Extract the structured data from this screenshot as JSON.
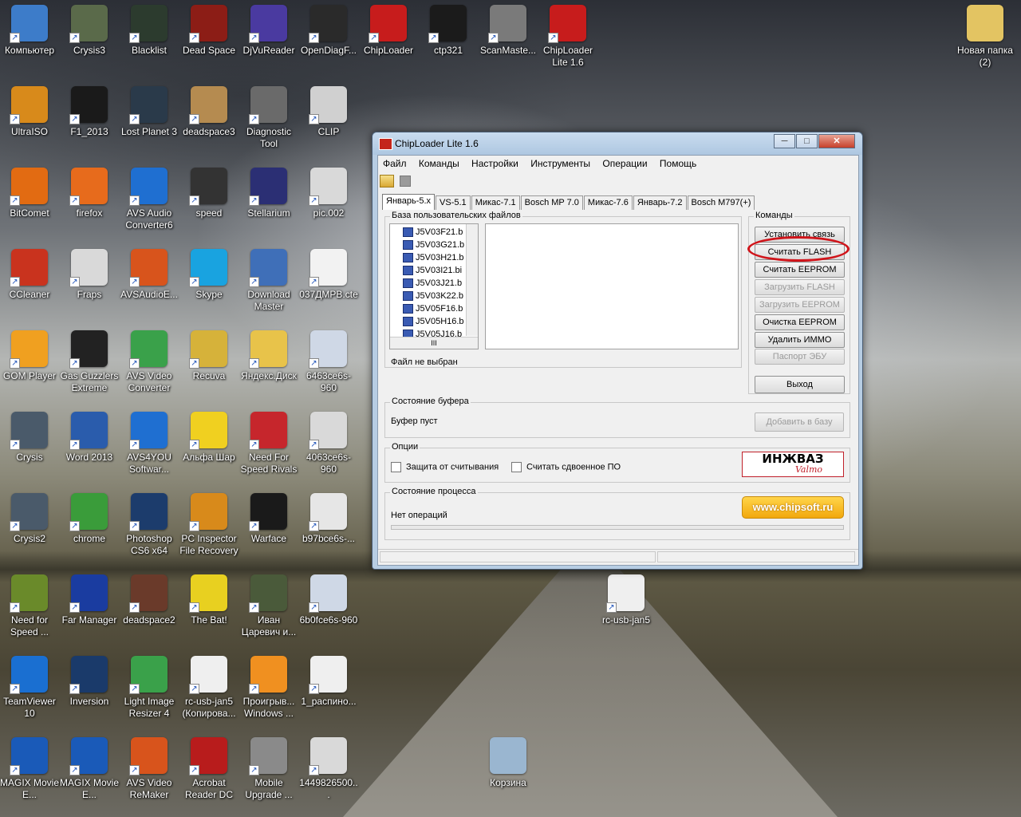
{
  "desktop": {
    "icons": [
      {
        "label": "Компьютер",
        "color": "#3d7cc9"
      },
      {
        "label": "Crysis3",
        "color": "#5a6a4a"
      },
      {
        "label": "Blacklist",
        "color": "#2c3b2e"
      },
      {
        "label": "Dead Space",
        "color": "#8c1d16"
      },
      {
        "label": "DjVuReader",
        "color": "#4a3aa0"
      },
      {
        "label": "OpenDiagF...",
        "color": "#2a2a2a"
      },
      {
        "label": "ChipLoader",
        "color": "#c71c1c"
      },
      {
        "label": "ctp321",
        "color": "#1b1b1b"
      },
      {
        "label": "ScanMaste...",
        "color": "#7a7a7a"
      },
      {
        "label": "ChipLoader Lite 1.6",
        "color": "#c71c1c"
      },
      {
        "label": "Новая папка (2)",
        "color": "#e3c462"
      },
      {
        "label": "UltraISO",
        "color": "#d88a1b"
      },
      {
        "label": "F1_2013",
        "color": "#1a1a1a"
      },
      {
        "label": "Lost Planet 3",
        "color": "#2a3a4a"
      },
      {
        "label": "deadspace3",
        "color": "#b58b50"
      },
      {
        "label": "Diagnostic Tool",
        "color": "#6a6a6a"
      },
      {
        "label": "CLIP",
        "color": "#d0d0d0"
      },
      {
        "label": "BitComet",
        "color": "#e26b12"
      },
      {
        "label": "firefox",
        "color": "#e76b1c"
      },
      {
        "label": "AVS Audio Converter6",
        "color": "#1f6fd1"
      },
      {
        "label": "speed",
        "color": "#333333"
      },
      {
        "label": "Stellarium",
        "color": "#2b2f74"
      },
      {
        "label": "pic.002",
        "color": "#d9d9d9"
      },
      {
        "label": "CCleaner",
        "color": "#c9331e"
      },
      {
        "label": "Fraps",
        "color": "#d9d9d9"
      },
      {
        "label": "AVSAudioE...",
        "color": "#d8541c"
      },
      {
        "label": "Skype",
        "color": "#19a3e0"
      },
      {
        "label": "Download Master",
        "color": "#3f6fb8"
      },
      {
        "label": "037ДМРВ.ctе",
        "color": "#f2f2f2"
      },
      {
        "label": "GOM Player",
        "color": "#f0a020"
      },
      {
        "label": "Gas Guzzlers Extreme",
        "color": "#222222"
      },
      {
        "label": "AVS Video Converter",
        "color": "#3aa14a"
      },
      {
        "label": "Recuva",
        "color": "#d6b23a"
      },
      {
        "label": "Яндекс.Диск",
        "color": "#e8c34a"
      },
      {
        "label": "6463ce6s-960",
        "color": "#cfd8e6"
      },
      {
        "label": "Crysis",
        "color": "#4a5a6a"
      },
      {
        "label": "Word 2013",
        "color": "#2a5cac"
      },
      {
        "label": "AVS4YOU Softwar...",
        "color": "#1f6fd1"
      },
      {
        "label": "Альфа Шар",
        "color": "#f0d020"
      },
      {
        "label": "Need For Speed Rivals",
        "color": "#c6262c"
      },
      {
        "label": "4063ce6s-960",
        "color": "#d9d9d9"
      },
      {
        "label": "Crysis2",
        "color": "#4a5a6a"
      },
      {
        "label": "chrome",
        "color": "#3a9c3a"
      },
      {
        "label": "Photoshop CS6 x64",
        "color": "#1c3c6c"
      },
      {
        "label": "PC Inspector File Recovery",
        "color": "#d88a1b"
      },
      {
        "label": "Warface",
        "color": "#1a1a1a"
      },
      {
        "label": "b97bce6s-...",
        "color": "#e6e6e6"
      },
      {
        "label": "Need for Speed ...",
        "color": "#6a8a2a"
      },
      {
        "label": "Far Manager",
        "color": "#1a3ca0"
      },
      {
        "label": "deadspace2",
        "color": "#6a3a2a"
      },
      {
        "label": "The Bat!",
        "color": "#e8d020"
      },
      {
        "label": "Иван Царевич и...",
        "color": "#4a5a3a"
      },
      {
        "label": "6b0fce6s-960",
        "color": "#cfd8e6"
      },
      {
        "label": "rc-usb-jan5",
        "color": "#efefef"
      },
      {
        "label": "TeamViewer 10",
        "color": "#1a6fd1"
      },
      {
        "label": "Inversion",
        "color": "#1a3a6a"
      },
      {
        "label": "Light Image Resizer 4",
        "color": "#3aa14a"
      },
      {
        "label": "rc-usb-jan5 (Копирова...",
        "color": "#efefef"
      },
      {
        "label": "Проигрыв... Windows ...",
        "color": "#f09020"
      },
      {
        "label": "1_распино...",
        "color": "#efefef"
      },
      {
        "label": "MAGIX Movie E...",
        "color": "#1a5ab8"
      },
      {
        "label": "MAGIX Movie E...",
        "color": "#1a5ab8"
      },
      {
        "label": "AVS Video ReMaker",
        "color": "#d8541c"
      },
      {
        "label": "Acrobat Reader DC",
        "color": "#b81c1c"
      },
      {
        "label": "Mobile Upgrade ...",
        "color": "#8a8a8a"
      },
      {
        "label": "1449826500...",
        "color": "#d9d9d9"
      },
      {
        "label": "Корзина",
        "color": "#9ab6d0"
      }
    ]
  },
  "window": {
    "title": "ChipLoader Lite 1.6",
    "controls": {
      "minimize": "─",
      "maximize": "□",
      "close": "✕"
    },
    "menu": [
      "Файл",
      "Команды",
      "Настройки",
      "Инструменты",
      "Операции",
      "Помощь"
    ],
    "tabs": [
      "Январь-5.x",
      "VS-5.1",
      "Микас-7.1",
      "Bosch MP 7.0",
      "Микас-7.6",
      "Январь-7.2",
      "Bosch M797(+)"
    ],
    "user_files": {
      "title": "База пользовательских файлов",
      "files": [
        "J5V03F21.b",
        "J5V03G21.b",
        "J5V03H21.b",
        "J5V03I21.bi",
        "J5V03J21.b",
        "J5V03K22.b",
        "J5V05F16.b",
        "J5V05H16.b",
        "J5V05J16.b"
      ],
      "status": "Файл не выбран"
    },
    "commands": {
      "title": "Команды",
      "buttons": [
        {
          "label": "Установить связь",
          "enabled": true
        },
        {
          "label": "Считать FLASH",
          "enabled": true
        },
        {
          "label": "Считать EEPROM",
          "enabled": true
        },
        {
          "label": "Загрузить FLASH",
          "enabled": false
        },
        {
          "label": "Загрузить EEPROM",
          "enabled": false
        },
        {
          "label": "Очистка EEPROM",
          "enabled": true
        },
        {
          "label": "Удалить ИММО",
          "enabled": true
        },
        {
          "label": "Паспорт ЭБУ",
          "enabled": false
        }
      ],
      "exit": "Выход"
    },
    "buffer": {
      "title": "Состояние буфера",
      "status": "Буфер пуст",
      "add_button": "Добавить в базу"
    },
    "options": {
      "title": "Опции",
      "protect": "Защита от считывания",
      "dual": "Считать сдвоенное ПО",
      "logo_top": "ИНЖВАЗ",
      "logo_bottom": "Valmo"
    },
    "process": {
      "title": "Состояние процесса",
      "status": "Нет операций",
      "link": "www.chipsoft.ru"
    },
    "tree_scroll": "III"
  }
}
